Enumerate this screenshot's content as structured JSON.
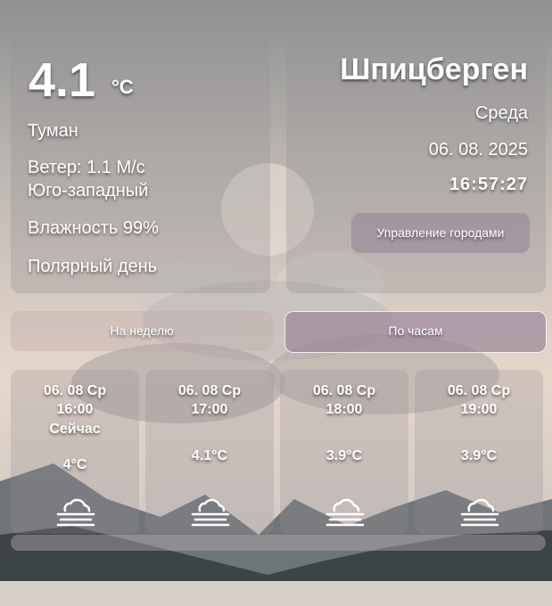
{
  "current": {
    "temp": "4.1",
    "unit": "°C",
    "condition": "Туман",
    "wind_line1": "Ветер: 1.1 М/с",
    "wind_line2": "Юго-западный",
    "humidity": "Влажность 99%",
    "daylight": "Полярный день"
  },
  "location": {
    "city": "Шпицберген",
    "weekday": "Среда",
    "date": "06. 08. 2025",
    "time": "16:57:27",
    "manage_label": "Управление городами"
  },
  "tabs": {
    "week_label": "На неделю",
    "hourly_label": "По часам"
  },
  "hourly": [
    {
      "date": "06. 08 Ср",
      "time": "16:00",
      "note": "Сейчас",
      "temp": "4°C",
      "icon": "fog-icon"
    },
    {
      "date": "06. 08 Ср",
      "time": "17:00",
      "note": "",
      "temp": "4.1°C",
      "icon": "fog-icon"
    },
    {
      "date": "06. 08 Ср",
      "time": "18:00",
      "note": "",
      "temp": "3.9°C",
      "icon": "fog-icon"
    },
    {
      "date": "06. 08 Ср",
      "time": "19:00",
      "note": "",
      "temp": "3.9°C",
      "icon": "fog-icon"
    }
  ],
  "colors": {
    "card_bg": "#968f96",
    "active_tab": "#968296",
    "text": "#ffffff"
  }
}
